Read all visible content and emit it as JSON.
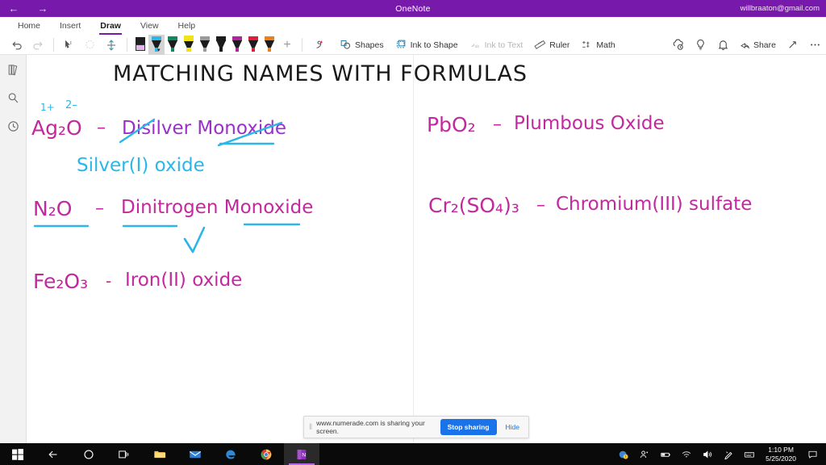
{
  "titlebar": {
    "back_icon": "back-arrow",
    "forward_icon": "forward-arrow",
    "app_title": "OneNote",
    "account": "willbraaton@gmail.com",
    "bg_color": "#7719aa"
  },
  "ribbon": {
    "tabs": [
      {
        "label": "Home",
        "active": false
      },
      {
        "label": "Insert",
        "active": false
      },
      {
        "label": "Draw",
        "active": true
      },
      {
        "label": "View",
        "active": false
      },
      {
        "label": "Help",
        "active": false
      }
    ],
    "tools": [
      {
        "name": "undo",
        "label": "Undo",
        "disabled": false
      },
      {
        "name": "redo",
        "label": "Redo",
        "disabled": true
      },
      {
        "name": "lasso-select",
        "label": "Lasso Select",
        "disabled": false
      },
      {
        "name": "select-ink",
        "label": "Select Ink",
        "disabled": true
      },
      {
        "name": "insert-space",
        "label": "Insert Space",
        "disabled": false
      }
    ],
    "pens": [
      {
        "name": "eraser",
        "label": "Eraser",
        "color": "#e0b8e8",
        "type": "eraser",
        "selected": false
      },
      {
        "name": "pen-cyan",
        "label": "Pen Cyan",
        "color": "#29b8e8",
        "type": "pen",
        "selected": true
      },
      {
        "name": "pen-green",
        "label": "Pen Green",
        "color": "#0e8a5f",
        "type": "pen",
        "selected": false
      },
      {
        "name": "highlighter-yellow",
        "label": "Highlighter Yellow",
        "color": "#f2e21a",
        "type": "highlighter",
        "selected": false
      },
      {
        "name": "pencil-gray",
        "label": "Pencil Gray",
        "color": "#9b9b9b",
        "type": "pencil",
        "selected": false
      },
      {
        "name": "pen-black",
        "label": "Pen Black",
        "color": "#1c1c1c",
        "type": "pen",
        "selected": false
      },
      {
        "name": "pen-magenta",
        "label": "Pen Magenta",
        "color": "#b3249c",
        "type": "pen",
        "selected": false
      },
      {
        "name": "pen-red",
        "label": "Pen Red",
        "color": "#e01b3c",
        "type": "pen",
        "selected": false
      },
      {
        "name": "pen-orange",
        "label": "Pen Orange",
        "color": "#ec8019",
        "type": "pen",
        "selected": false
      }
    ],
    "add_pen_label": "+",
    "buttons": [
      {
        "name": "ink-replay",
        "label": "",
        "icon": "ink-replay-icon",
        "disabled": false
      },
      {
        "name": "shapes",
        "label": "Shapes",
        "icon": "shapes-icon",
        "disabled": false
      },
      {
        "name": "ink-to-shape",
        "label": "Ink to Shape",
        "icon": "ink-to-shape-icon",
        "disabled": false
      },
      {
        "name": "ink-to-text",
        "label": "Ink to Text",
        "icon": "ink-to-text-icon",
        "disabled": true
      },
      {
        "name": "ruler",
        "label": "Ruler",
        "icon": "ruler-icon",
        "disabled": false
      },
      {
        "name": "math",
        "label": "Math",
        "icon": "math-icon",
        "disabled": false
      }
    ],
    "right_icons": [
      {
        "name": "sync-icon",
        "label": "Sync"
      },
      {
        "name": "lightbulb-icon",
        "label": "Tell me"
      },
      {
        "name": "bell-icon",
        "label": "Notifications"
      }
    ],
    "share_label": "Share",
    "expand_icon": "expand-icon",
    "more_icon": "more-options-icon"
  },
  "rail": {
    "items": [
      {
        "name": "notebooks",
        "icon": "notebooks-icon",
        "label": "Notebooks"
      },
      {
        "name": "search",
        "icon": "search-icon",
        "label": "Search"
      },
      {
        "name": "recent",
        "icon": "recent-clock-icon",
        "label": "Recent Notes"
      }
    ]
  },
  "canvas": {
    "title": "MATCHING NAMES WITH FORMULAS",
    "title_color": "#1a1a1a",
    "ink_colors": {
      "magenta": "#c2299f",
      "purple": "#9b2fc9",
      "cyan": "#2bb6e8",
      "black": "#1a1a1a"
    },
    "left_column": [
      {
        "name": "ag2o-entry",
        "formula": "Ag₂O",
        "dash": "–",
        "wrong_name": "Disilver Monoxide",
        "correct_name": "Silver(I) oxide",
        "charge_cation": "1+",
        "charge_anion": "2–"
      },
      {
        "name": "n2o-entry",
        "formula": "N₂O",
        "dash": "–",
        "correct_name": "Dinitrogen Monoxide",
        "mark": "✓"
      },
      {
        "name": "fe2o3-entry",
        "formula": "Fe₂O₃",
        "dash": "-",
        "correct_name": "Iron(II) oxide"
      }
    ],
    "right_column": [
      {
        "name": "pbo2-entry",
        "formula": "PbO₂",
        "dash": "–",
        "correct_name": "Plumbous Oxide"
      },
      {
        "name": "cr2so43-entry",
        "formula": "Cr₂(SO₄)₃",
        "dash": "–",
        "correct_name": "Chromium(III) sulfate"
      }
    ]
  },
  "sharebar": {
    "message": "www.numerade.com is sharing your screen.",
    "stop_label": "Stop sharing",
    "hide_label": "Hide",
    "accent_color": "#1a73e8"
  },
  "taskbar": {
    "items": [
      {
        "name": "start-button",
        "icon": "windows-logo-icon"
      },
      {
        "name": "back-button",
        "icon": "back-arrow-icon"
      },
      {
        "name": "cortana-button",
        "icon": "cortana-circle-icon"
      },
      {
        "name": "task-view-button",
        "icon": "task-view-icon"
      },
      {
        "name": "file-explorer",
        "icon": "folder-icon"
      },
      {
        "name": "mail",
        "icon": "mail-icon"
      },
      {
        "name": "edge",
        "icon": "edge-icon"
      },
      {
        "name": "chrome",
        "icon": "chrome-icon"
      },
      {
        "name": "onenote",
        "icon": "onenote-icon",
        "active": true
      }
    ],
    "tray": [
      {
        "name": "network-warning-icon"
      },
      {
        "name": "people-icon"
      },
      {
        "name": "battery-icon"
      },
      {
        "name": "wifi-icon"
      },
      {
        "name": "volume-icon"
      },
      {
        "name": "pen-workspace-icon"
      },
      {
        "name": "touch-keyboard-icon"
      }
    ],
    "time": "1:10 PM",
    "date": "5/25/2020",
    "action_center_icon": "action-center-icon"
  }
}
